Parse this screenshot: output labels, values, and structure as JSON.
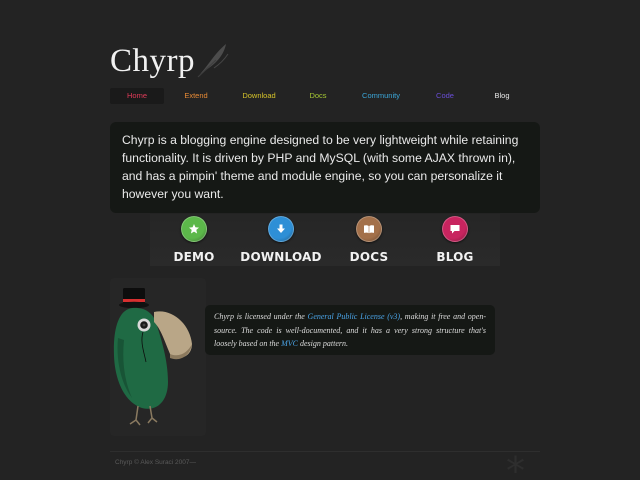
{
  "logo": {
    "text": "Chyrp"
  },
  "nav": {
    "items": [
      {
        "label": "Home",
        "color": "#e23b59"
      },
      {
        "label": "Extend",
        "color": "#e78a35"
      },
      {
        "label": "Download",
        "color": "#d6c42a"
      },
      {
        "label": "Docs",
        "color": "#a6c834"
      },
      {
        "label": "Community",
        "color": "#3ba6d8"
      },
      {
        "label": "Code",
        "color": "#6a4ed8"
      },
      {
        "label": "Blog",
        "color": "#e8e8e8"
      }
    ]
  },
  "intro": {
    "text": "Chyrp is a blogging engine designed to be very lightweight while retaining functionality. It is driven by PHP and MySQL (with some AJAX thrown in), and has a pimpin' theme and module engine, so you can personalize it however you want."
  },
  "features": [
    {
      "label": "DEMO",
      "icon": "star-icon",
      "color": "#5cb84a"
    },
    {
      "label": "DOWNLOAD",
      "icon": "download-arrow-icon",
      "color": "#2e8fd6"
    },
    {
      "label": "DOCS",
      "icon": "book-icon",
      "color": "#a3704a"
    },
    {
      "label": "BLOG",
      "icon": "speech-bubble-icon",
      "color": "#c8245f"
    }
  ],
  "license": {
    "part1": "Chyrp is licensed under the ",
    "gpl_link": "General Public License (v3)",
    "part2": ", making it free and open-source. The code is well-documented, and it has a very strong structure that's loosely based on the ",
    "mvc_link": "MVC",
    "part3": " design pattern."
  },
  "footer": {
    "text": "Chyrp © Alex Suraci 2007—"
  }
}
